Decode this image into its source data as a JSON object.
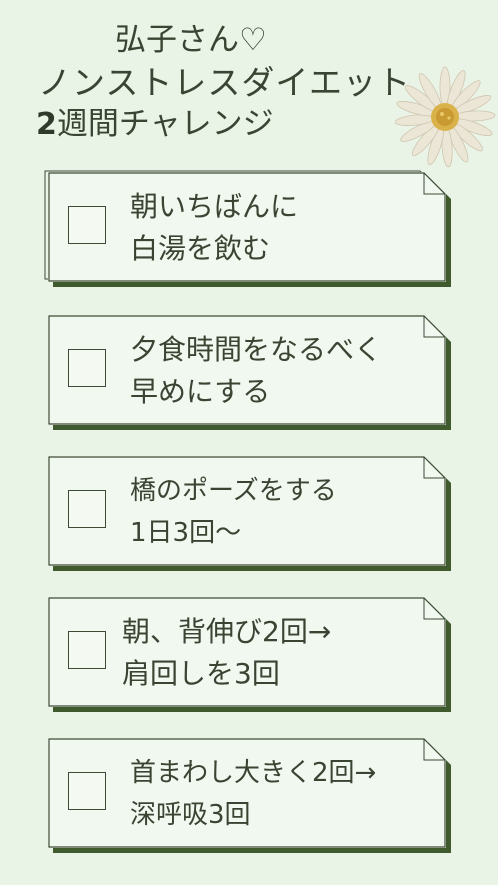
{
  "title": {
    "line1": "弘子さん♡",
    "line2": "ノンストレスダイエット",
    "line3_number": "2",
    "line3_text": "週間チャレンジ"
  },
  "checklist": [
    {
      "line1": "朝いちばんに",
      "line2": "白湯を飲む",
      "checked": false
    },
    {
      "line1": "夕食時間をなるべく",
      "line2": "早めにする",
      "checked": false
    },
    {
      "line1": " 橋のポーズをする",
      "line2": "1日3回〜",
      "checked": false
    },
    {
      "line1": "朝、背伸び2回→",
      "line2": "肩回しを3回",
      "checked": false
    },
    {
      "line1": "首まわし大きく2回→",
      "line2": "深呼吸3回",
      "checked": false
    }
  ],
  "colors": {
    "background": "#e9f3e6",
    "card": "#f1f8ef",
    "card_shadow": "#3f5b2e",
    "text": "#3a4433"
  },
  "decoration": "daisy-flower-icon"
}
